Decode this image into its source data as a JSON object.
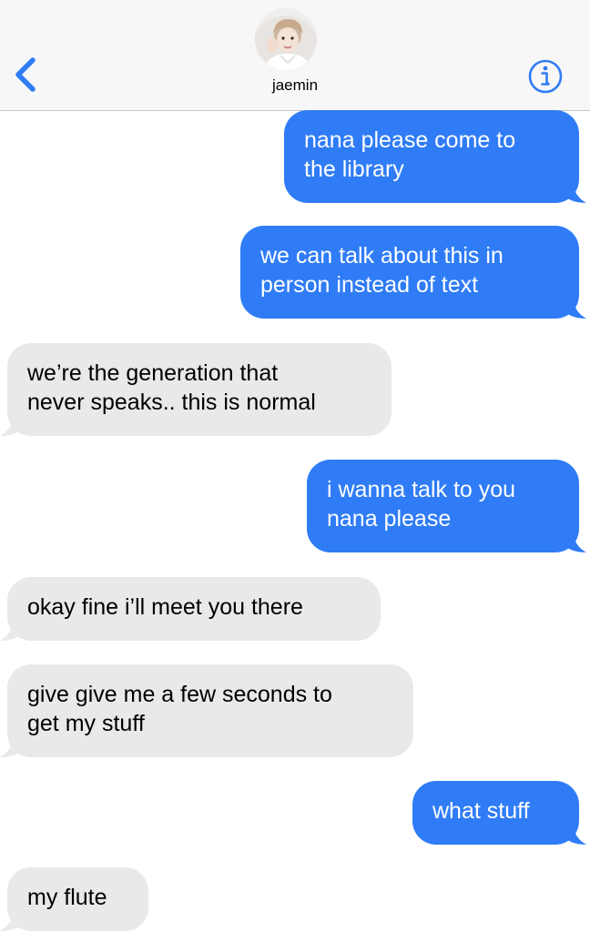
{
  "header": {
    "contact_name": "jaemin"
  },
  "icons": {
    "back": "chevron-left-icon",
    "info": "info-circle-icon",
    "avatar": "contact-photo"
  },
  "colors": {
    "sent_bubble": "#2f7cf6",
    "received_bubble": "#e9e9eb",
    "accent": "#2f7cf6",
    "header_bg": "#f7f7f7"
  },
  "messages": [
    {
      "direction": "sent",
      "lines": [
        "nana please come to",
        "the library"
      ]
    },
    {
      "direction": "sent",
      "lines": [
        "we can talk about this in",
        "person instead of text"
      ]
    },
    {
      "direction": "received",
      "lines": [
        "we’re the generation that",
        "never speaks.. this is normal"
      ]
    },
    {
      "direction": "sent",
      "lines": [
        "i wanna talk to you",
        "nana please"
      ]
    },
    {
      "direction": "received",
      "lines": [
        "okay fine i’ll meet you there"
      ]
    },
    {
      "direction": "received",
      "lines": [
        "give give me a few seconds to",
        "get my stuff"
      ]
    },
    {
      "direction": "sent",
      "lines": [
        "what stuff"
      ]
    },
    {
      "direction": "received",
      "lines": [
        "my flute"
      ]
    }
  ]
}
